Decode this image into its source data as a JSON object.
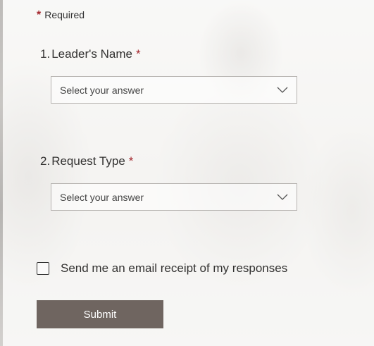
{
  "required_note": {
    "star": "*",
    "label": "Required"
  },
  "questions": [
    {
      "number": "1.",
      "label": "Leader's Name",
      "required_star": "*",
      "placeholder": "Select your answer",
      "icon": "chevron-down-icon"
    },
    {
      "number": "2.",
      "label": "Request Type",
      "required_star": "*",
      "placeholder": "Select your answer",
      "icon": "chevron-down-icon"
    }
  ],
  "receipt": {
    "label": "Send me an email receipt of my responses",
    "checked": false
  },
  "submit": {
    "label": "Submit"
  },
  "colors": {
    "required_star": "#a4262c",
    "submit_background": "#6f6560",
    "text": "#323130"
  }
}
